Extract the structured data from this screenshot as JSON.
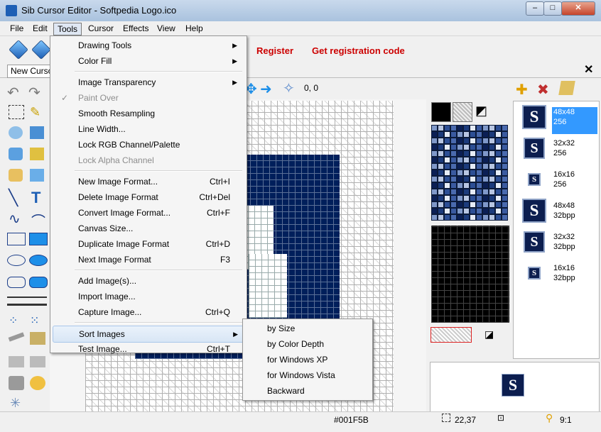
{
  "window": {
    "title": "Sib Cursor Editor - Softpedia Logo.ico",
    "minimize": "–",
    "maximize": "□",
    "close": "✕"
  },
  "menubar": [
    "File",
    "Edit",
    "Tools",
    "Cursor",
    "Effects",
    "View",
    "Help"
  ],
  "toolbar": {
    "register": "Register",
    "get_code": "Get registration code",
    "coords": "0, 0"
  },
  "tab": {
    "label": "New Cursor",
    "close": "✕"
  },
  "tools_menu": [
    {
      "label": "Drawing Tools",
      "submenu": true
    },
    {
      "label": "Color Fill",
      "submenu": true
    },
    {
      "label": "Image Transparency",
      "submenu": true
    },
    {
      "label": "Paint Over",
      "disabled": true,
      "checked": true
    },
    {
      "label": "Smooth Resampling"
    },
    {
      "label": "Line Width..."
    },
    {
      "label": "Lock RGB Channel/Palette"
    },
    {
      "label": "Lock Alpha Channel",
      "disabled": true
    },
    {
      "label": "New Image Format...",
      "shortcut": "Ctrl+I"
    },
    {
      "label": "Delete Image Format",
      "shortcut": "Ctrl+Del"
    },
    {
      "label": "Convert Image Format...",
      "shortcut": "Ctrl+F"
    },
    {
      "label": "Canvas Size..."
    },
    {
      "label": "Duplicate Image Format",
      "shortcut": "Ctrl+D"
    },
    {
      "label": "Next Image Format",
      "shortcut": "F3"
    },
    {
      "label": "Add Image(s)..."
    },
    {
      "label": "Import Image..."
    },
    {
      "label": "Capture Image...",
      "shortcut": "Ctrl+Q"
    },
    {
      "label": "Sort Images",
      "submenu": true,
      "highlight": true
    },
    {
      "label": "Test Image...",
      "shortcut": "Ctrl+T"
    }
  ],
  "sort_menu": [
    "by Size",
    "by Color Depth",
    "for Windows XP",
    "for Windows Vista",
    "Backward"
  ],
  "formats": [
    {
      "size": "48x48",
      "depth": "256",
      "selected": true
    },
    {
      "size": "32x32",
      "depth": "256"
    },
    {
      "size": "16x16",
      "depth": "256"
    },
    {
      "size": "48x48",
      "depth": "32bpp"
    },
    {
      "size": "32x32",
      "depth": "32bpp"
    },
    {
      "size": "16x16",
      "depth": "32bpp"
    }
  ],
  "status": {
    "color": "#001F5B",
    "position": "22,37",
    "zoom": "9:1"
  },
  "colors": {
    "icon_bg": "#001F5B",
    "link_red": "#cc0000",
    "selection": "#3399ff"
  },
  "icons": [
    "new-icon",
    "open-icon",
    "undo-icon",
    "redo-icon",
    "select-rect-icon",
    "pencil-icon",
    "line-icon",
    "text-icon",
    "rectangle-icon",
    "ellipse-icon",
    "rounded-rect-icon",
    "arrows-icon",
    "magic-wand-icon",
    "add-format-icon",
    "delete-format-icon",
    "layers-icon",
    "zoom-icon"
  ]
}
